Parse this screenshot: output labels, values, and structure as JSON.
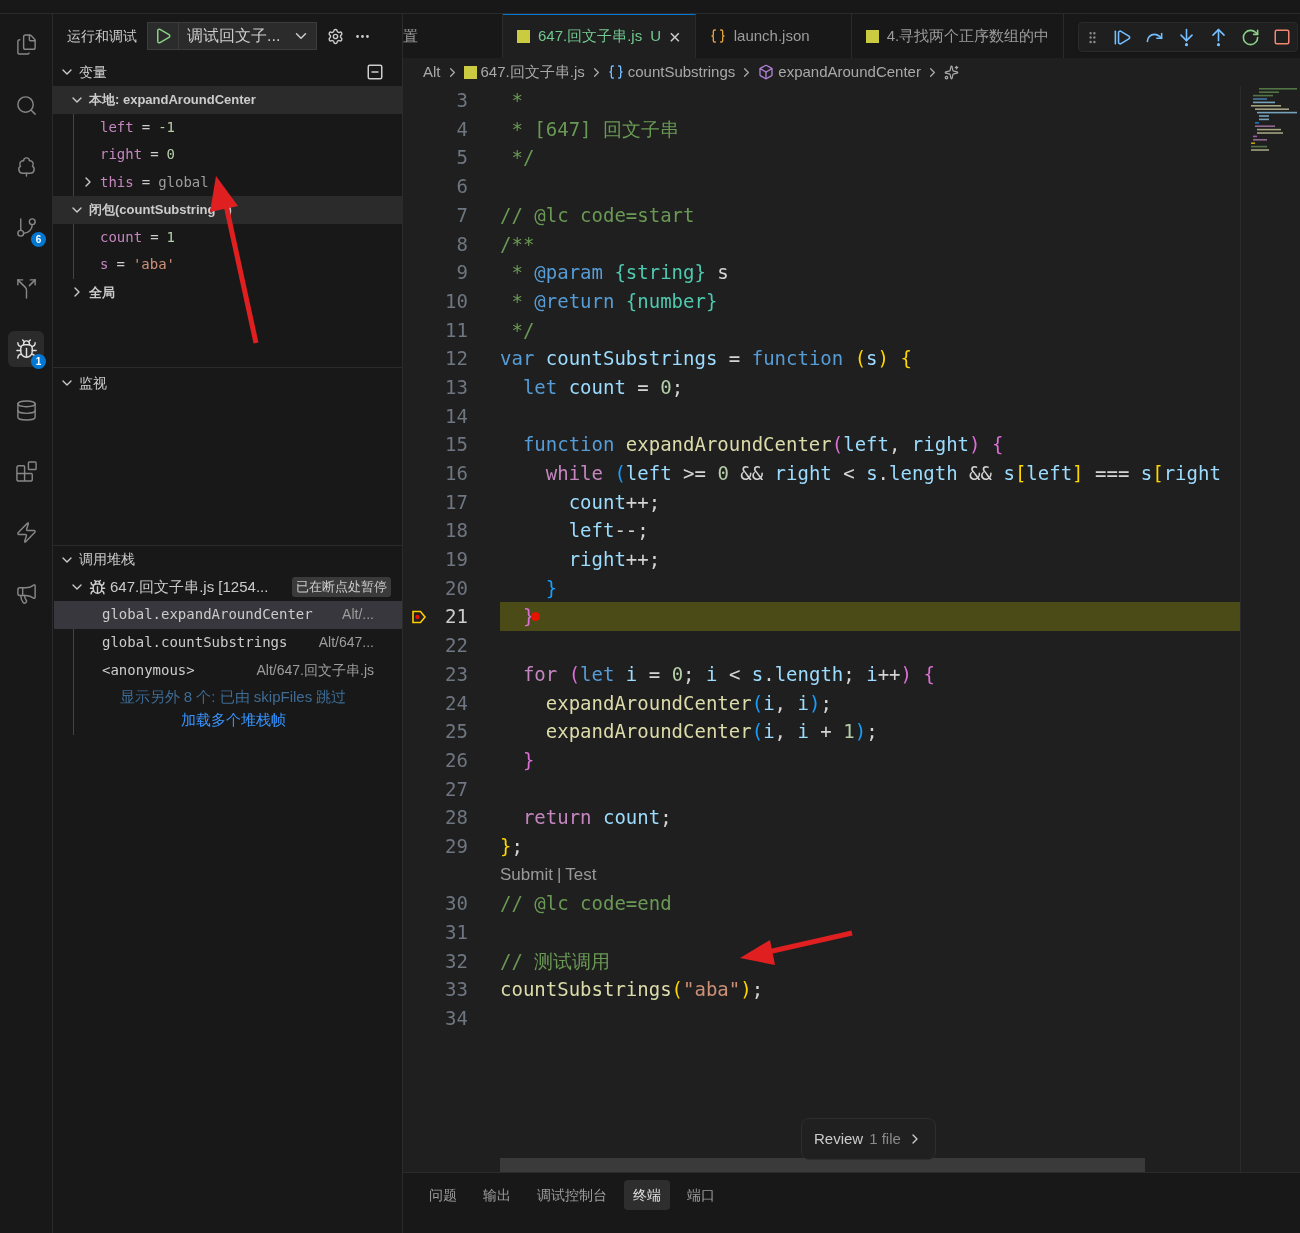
{
  "activity_bar": {
    "items": [
      {
        "kind": "files",
        "selected": false
      },
      {
        "kind": "search",
        "selected": false
      },
      {
        "kind": "tree",
        "selected": false
      },
      {
        "kind": "branch",
        "selected": false,
        "badge": "6"
      },
      {
        "kind": "fork",
        "selected": false
      },
      {
        "kind": "debug",
        "selected": true,
        "badge": "1"
      },
      {
        "kind": "database",
        "selected": false
      },
      {
        "kind": "blocks",
        "selected": false
      },
      {
        "kind": "bolt",
        "selected": false
      },
      {
        "kind": "megaphone",
        "selected": false
      }
    ]
  },
  "sidebar": {
    "title": "运行和调试",
    "config": "调试回文子...",
    "variables": {
      "title": "变量",
      "expanded": true,
      "scopes": [
        {
          "label": "本地: expandAroundCenter",
          "expanded": true,
          "vars": [
            {
              "name": "left",
              "sign": "=",
              "value": "-1",
              "kind": "number"
            },
            {
              "name": "right",
              "sign": "=",
              "value": "0",
              "kind": "number"
            },
            {
              "name": "this",
              "sign": "=",
              "value": "global",
              "kind": "object",
              "expanded": false
            }
          ]
        },
        {
          "label": "闭包(countSubstring",
          "label_tail": ")",
          "expanded": true,
          "vars": [
            {
              "name": "count",
              "sign": "=",
              "value": "1",
              "kind": "number"
            },
            {
              "name": "s",
              "sign": "=",
              "value": "'aba'",
              "kind": "string"
            }
          ]
        },
        {
          "label": "全局",
          "expanded": false
        }
      ]
    },
    "watch": {
      "title": "监视",
      "expanded": true
    },
    "call_stack": {
      "title": "调用堆栈",
      "expanded": true,
      "thread": {
        "name": "647.回文子串.js [1254...",
        "status": "已在断点处暂停",
        "expanded": true
      },
      "frames": [
        {
          "function": "global.expandAroundCenter",
          "source": "Alt/...",
          "selected": true
        },
        {
          "function": "global.countSubstrings",
          "source": "Alt/647...",
          "selected": false
        },
        {
          "function": "<anonymous>",
          "source": "Alt/647.回文子串.js",
          "selected": false
        }
      ],
      "skipped": "显示另外 8 个: 已由 skipFiles 跳过",
      "load_more": "加载多个堆栈帧"
    }
  },
  "tabs": [
    {
      "label": "置",
      "kind": "settings",
      "selected": false
    },
    {
      "label": "647.回文子串.js",
      "kind": "js",
      "selected": true,
      "status": "U",
      "close": "×"
    },
    {
      "label": "launch.json",
      "kind": "json",
      "selected": false
    },
    {
      "label": "4.寻找两个正序数组的中",
      "kind": "js",
      "selected": false
    }
  ],
  "breadcrumbs": [
    {
      "label": "Alt",
      "kind": "folder"
    },
    {
      "label": "647.回文子串.js",
      "kind": "js"
    },
    {
      "label": "countSubstrings",
      "kind": "variable"
    },
    {
      "label": "expandAroundCenter",
      "kind": "method"
    }
  ],
  "code": [
    {
      "number": "3",
      "tokens": [
        {
          "kind": "c",
          "text": " *"
        }
      ]
    },
    {
      "number": "4",
      "tokens": [
        {
          "kind": "c",
          "text": " * [647] 回文子串"
        }
      ]
    },
    {
      "number": "5",
      "tokens": [
        {
          "kind": "c",
          "text": " */"
        }
      ]
    },
    {
      "number": "6"
    },
    {
      "number": "7",
      "tokens": [
        {
          "kind": "c",
          "text": "// @lc code=start"
        }
      ]
    },
    {
      "number": "8",
      "tokens": [
        {
          "kind": "c",
          "text": "/**"
        }
      ]
    },
    {
      "number": "9",
      "tokens": [
        {
          "kind": "c",
          "text": " *"
        },
        {
          "kind": "tag",
          "text": " @param"
        },
        {
          "kind": "type",
          "text": " {string}"
        },
        {
          "kind": "t",
          "text": " s"
        }
      ]
    },
    {
      "number": "10",
      "tokens": [
        {
          "kind": "c",
          "text": " *"
        },
        {
          "kind": "tag",
          "text": " @return"
        },
        {
          "kind": "type",
          "text": " {number}"
        }
      ]
    },
    {
      "number": "11",
      "tokens": [
        {
          "kind": "c",
          "text": " */"
        }
      ]
    },
    {
      "number": "12",
      "tokens": [
        {
          "kind": "k",
          "text": "var"
        },
        {
          "kind": "v",
          "text": " countSubstrings"
        },
        {
          "kind": "t",
          "text": " = "
        },
        {
          "kind": "k",
          "text": "function"
        },
        {
          "kind": "b1",
          "text": " ("
        },
        {
          "kind": "v",
          "text": "s"
        },
        {
          "kind": "b1",
          "text": ") {"
        }
      ]
    },
    {
      "number": "13",
      "tokens": [
        {
          "kind": "k",
          "text": "  let"
        },
        {
          "kind": "v",
          "text": " count"
        },
        {
          "kind": "t",
          "text": " = "
        },
        {
          "kind": "n",
          "text": "0"
        },
        {
          "kind": "t",
          "text": ";"
        }
      ]
    },
    {
      "number": "14"
    },
    {
      "number": "15",
      "tokens": [
        {
          "kind": "k",
          "text": "  function"
        },
        {
          "kind": "f",
          "text": " expandAroundCenter"
        },
        {
          "kind": "b2",
          "text": "("
        },
        {
          "kind": "v",
          "text": "left"
        },
        {
          "kind": "t",
          "text": ", "
        },
        {
          "kind": "v",
          "text": "right"
        },
        {
          "kind": "b2",
          "text": ") {"
        }
      ]
    },
    {
      "number": "16",
      "tokens": [
        {
          "kind": "ctl",
          "text": "    while"
        },
        {
          "kind": "b3",
          "text": " ("
        },
        {
          "kind": "v",
          "text": "left"
        },
        {
          "kind": "t",
          "text": " >= "
        },
        {
          "kind": "n",
          "text": "0"
        },
        {
          "kind": "t",
          "text": " && "
        },
        {
          "kind": "v",
          "text": "right"
        },
        {
          "kind": "t",
          "text": " < "
        },
        {
          "kind": "v",
          "text": "s"
        },
        {
          "kind": "t",
          "text": "."
        },
        {
          "kind": "v",
          "text": "length"
        },
        {
          "kind": "t",
          "text": " && "
        },
        {
          "kind": "v",
          "text": "s"
        },
        {
          "kind": "b1",
          "text": "["
        },
        {
          "kind": "v",
          "text": "left"
        },
        {
          "kind": "b1",
          "text": "]"
        },
        {
          "kind": "t",
          "text": " === "
        },
        {
          "kind": "v",
          "text": "s"
        },
        {
          "kind": "b1",
          "text": "["
        },
        {
          "kind": "v",
          "text": "right"
        }
      ]
    },
    {
      "number": "17",
      "tokens": [
        {
          "kind": "v",
          "text": "      count"
        },
        {
          "kind": "t",
          "text": "++;"
        }
      ]
    },
    {
      "number": "18",
      "tokens": [
        {
          "kind": "v",
          "text": "      left"
        },
        {
          "kind": "t",
          "text": "--;"
        }
      ]
    },
    {
      "number": "19",
      "tokens": [
        {
          "kind": "v",
          "text": "      right"
        },
        {
          "kind": "t",
          "text": "++;"
        }
      ]
    },
    {
      "number": "20",
      "tokens": [
        {
          "kind": "b3",
          "text": "    }"
        }
      ]
    },
    {
      "number": "21",
      "current": true,
      "breakpoint": true,
      "tokens": [
        {
          "kind": "b2",
          "text": "  }"
        }
      ]
    },
    {
      "number": "22"
    },
    {
      "number": "23",
      "tokens": [
        {
          "kind": "ctl",
          "text": "  for"
        },
        {
          "kind": "b2",
          "text": " ("
        },
        {
          "kind": "k",
          "text": "let"
        },
        {
          "kind": "v",
          "text": " i"
        },
        {
          "kind": "t",
          "text": " = "
        },
        {
          "kind": "n",
          "text": "0"
        },
        {
          "kind": "t",
          "text": "; "
        },
        {
          "kind": "v",
          "text": "i"
        },
        {
          "kind": "t",
          "text": " < "
        },
        {
          "kind": "v",
          "text": "s"
        },
        {
          "kind": "t",
          "text": "."
        },
        {
          "kind": "v",
          "text": "length"
        },
        {
          "kind": "t",
          "text": "; "
        },
        {
          "kind": "v",
          "text": "i"
        },
        {
          "kind": "t",
          "text": "++"
        },
        {
          "kind": "b2",
          "text": ") {"
        }
      ]
    },
    {
      "number": "24",
      "tokens": [
        {
          "kind": "f",
          "text": "    expandAroundCenter"
        },
        {
          "kind": "b3",
          "text": "("
        },
        {
          "kind": "v",
          "text": "i"
        },
        {
          "kind": "t",
          "text": ", "
        },
        {
          "kind": "v",
          "text": "i"
        },
        {
          "kind": "b3",
          "text": ")"
        },
        {
          "kind": "t",
          "text": ";"
        }
      ]
    },
    {
      "number": "25",
      "tokens": [
        {
          "kind": "f",
          "text": "    expandAroundCenter"
        },
        {
          "kind": "b3",
          "text": "("
        },
        {
          "kind": "v",
          "text": "i"
        },
        {
          "kind": "t",
          "text": ", "
        },
        {
          "kind": "v",
          "text": "i"
        },
        {
          "kind": "t",
          "text": " + "
        },
        {
          "kind": "n",
          "text": "1"
        },
        {
          "kind": "b3",
          "text": ")"
        },
        {
          "kind": "t",
          "text": ";"
        }
      ]
    },
    {
      "number": "26",
      "tokens": [
        {
          "kind": "b2",
          "text": "  }"
        }
      ]
    },
    {
      "number": "27"
    },
    {
      "number": "28",
      "tokens": [
        {
          "kind": "ctl",
          "text": "  return"
        },
        {
          "kind": "v",
          "text": " count"
        },
        {
          "kind": "t",
          "text": ";"
        }
      ]
    },
    {
      "number": "29",
      "tokens": [
        {
          "kind": "b1",
          "text": "}"
        },
        {
          "kind": "t",
          "text": ";"
        }
      ]
    },
    {
      "kind": "codelens",
      "links": [
        "Submit",
        "Test"
      ],
      "separator": "|"
    },
    {
      "number": "30",
      "tokens": [
        {
          "kind": "c",
          "text": "// @lc code=end"
        }
      ]
    },
    {
      "number": "31"
    },
    {
      "number": "32",
      "tokens": [
        {
          "kind": "c",
          "text": "// 测试调用"
        }
      ]
    },
    {
      "number": "33",
      "tokens": [
        {
          "kind": "f",
          "text": "countSubstrings"
        },
        {
          "kind": "b1",
          "text": "("
        },
        {
          "kind": "s",
          "text": "\"aba\""
        },
        {
          "kind": "b1",
          "text": ")"
        },
        {
          "kind": "t",
          "text": ";"
        }
      ]
    },
    {
      "number": "34"
    }
  ],
  "review": {
    "label": "Review",
    "count": "1 file"
  },
  "panel_tabs": [
    {
      "label": "问题",
      "selected": false
    },
    {
      "label": "输出",
      "selected": false
    },
    {
      "label": "调试控制台",
      "selected": false
    },
    {
      "label": "终端",
      "selected": true
    },
    {
      "label": "端口",
      "selected": false
    }
  ]
}
